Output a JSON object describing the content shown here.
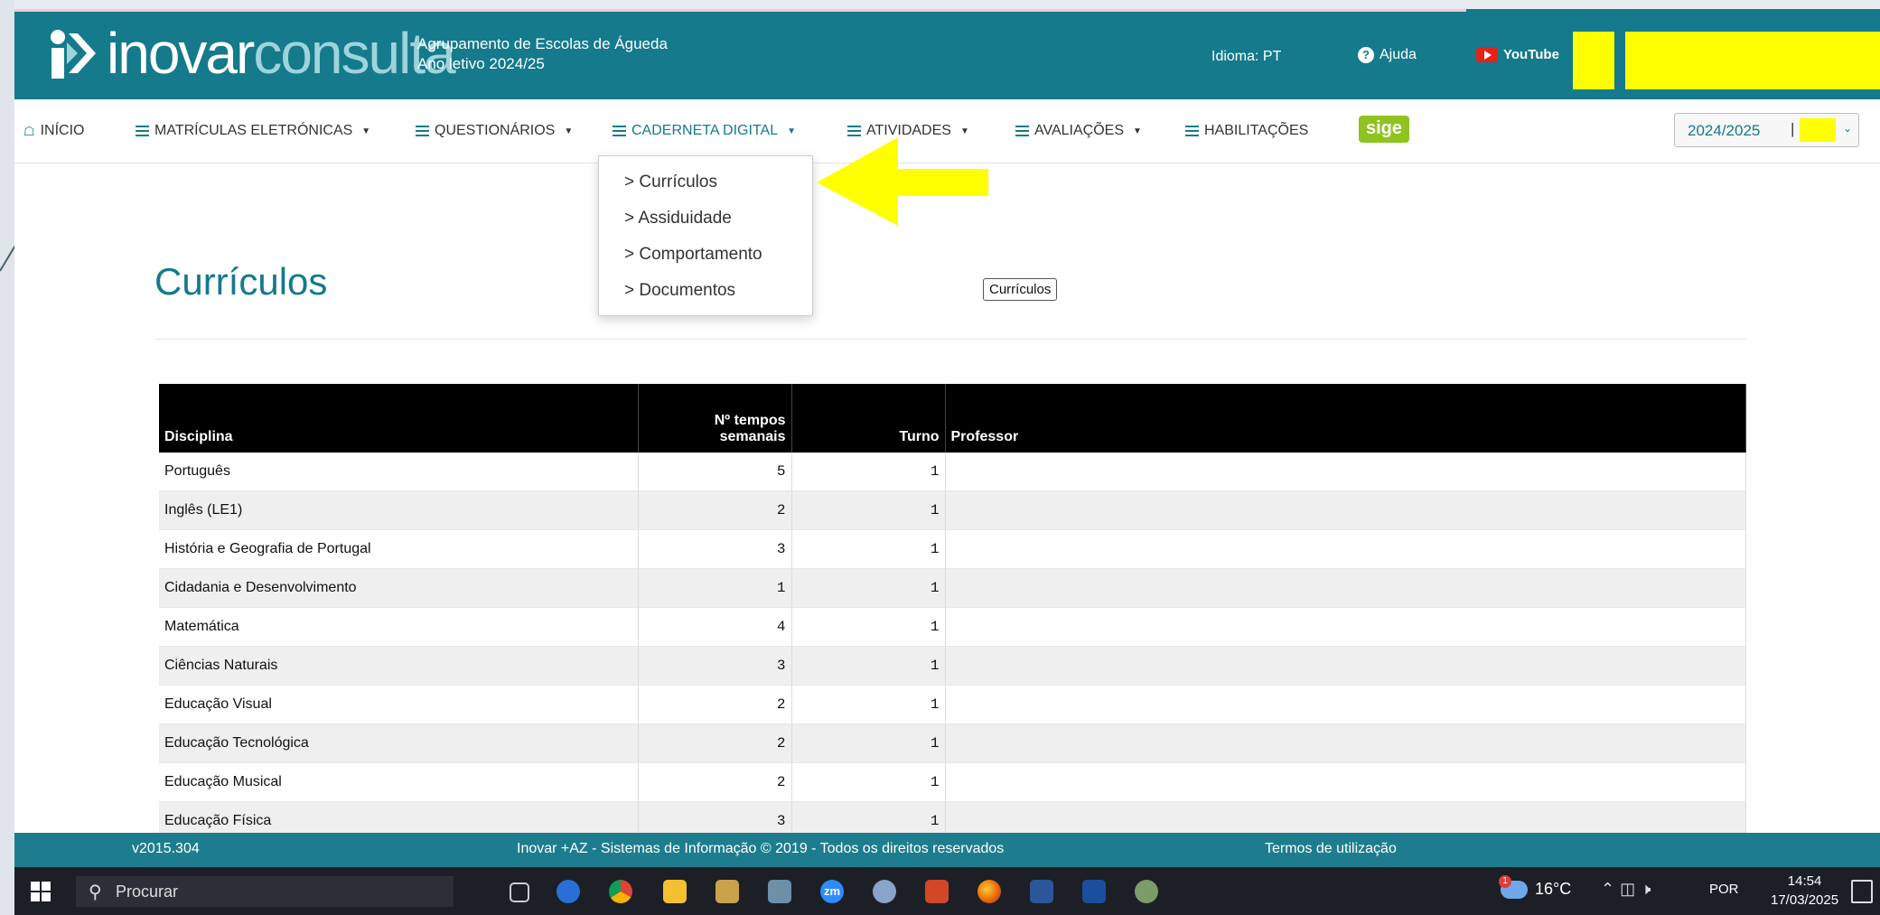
{
  "header": {
    "logo_bold": "inovar",
    "logo_light": "consulta",
    "school_name": "Agrupamento de Escolas de Águeda",
    "school_year": "Ano letivo 2024/25",
    "language": "Idioma: PT",
    "help": "Ajuda",
    "youtube": "YouTube"
  },
  "nav": {
    "inicio": "INÍCIO",
    "matriculas": "MATRÍCULAS ELETRÓNICAS",
    "questionarios": "QUESTIONÁRIOS",
    "caderneta": "CADERNETA DIGITAL",
    "atividades": "ATIVIDADES",
    "avaliacoes": "AVALIAÇÕES",
    "habilitacoes": "HABILITAÇÕES",
    "sige": "sige",
    "year_selected": "2024/2025",
    "year_separator": "|"
  },
  "dropdown": {
    "items": [
      "Currículos",
      "Assiduidade",
      "Comportamento",
      "Documentos"
    ],
    "bullet": ">"
  },
  "page": {
    "title": "Currículos",
    "button": "Currículos"
  },
  "table": {
    "headers": {
      "disciplina": "Disciplina",
      "tempos_line1": "Nº tempos",
      "tempos_line2": "semanais",
      "turno": "Turno",
      "professor": "Professor"
    },
    "rows": [
      {
        "disciplina": "Português",
        "tempos": "5",
        "turno": "1",
        "professor": ""
      },
      {
        "disciplina": "Inglês (LE1)",
        "tempos": "2",
        "turno": "1",
        "professor": ""
      },
      {
        "disciplina": "História e Geografia de Portugal",
        "tempos": "3",
        "turno": "1",
        "professor": ""
      },
      {
        "disciplina": "Cidadania e Desenvolvimento",
        "tempos": "1",
        "turno": "1",
        "professor": ""
      },
      {
        "disciplina": "Matemática",
        "tempos": "4",
        "turno": "1",
        "professor": ""
      },
      {
        "disciplina": "Ciências Naturais",
        "tempos": "3",
        "turno": "1",
        "professor": ""
      },
      {
        "disciplina": "Educação Visual",
        "tempos": "2",
        "turno": "1",
        "professor": ""
      },
      {
        "disciplina": "Educação Tecnológica",
        "tempos": "2",
        "turno": "1",
        "professor": ""
      },
      {
        "disciplina": "Educação Musical",
        "tempos": "2",
        "turno": "1",
        "professor": ""
      },
      {
        "disciplina": "Educação Física",
        "tempos": "3",
        "turno": "1",
        "professor": ""
      }
    ]
  },
  "footer": {
    "version": "v2015.304",
    "copyright": "Inovar +AZ - Sistemas de Informação © 2019 - Todos os direitos reservados",
    "terms": "Termos de utilização"
  },
  "taskbar": {
    "search_placeholder": "Procurar",
    "apps": [
      "task-view",
      "clock-app",
      "chrome",
      "file-explorer",
      "paint-app",
      "calculator",
      "zoom",
      "sketch-app",
      "powerpoint",
      "firefox",
      "word",
      "app-c",
      "paint-brush-app"
    ],
    "zoom_label": "zm",
    "weather": "16°C",
    "weather_badge": "1",
    "input_language": "POR",
    "time": "14:54",
    "date": "17/03/2025"
  },
  "colors": {
    "brand_teal": "#147a8c",
    "highlight_yellow": "#ffff00",
    "sige_green": "#8fc31f",
    "table_header": "#000000"
  }
}
